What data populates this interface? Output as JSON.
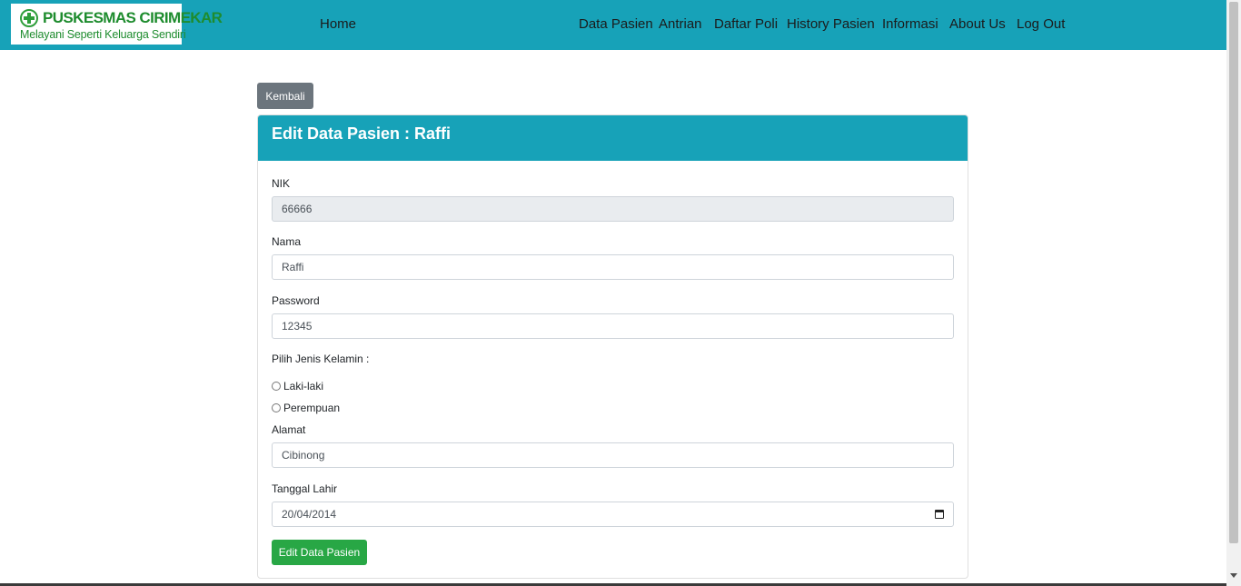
{
  "navbar": {
    "logo_title": "PUSKESMAS CIRIMEKAR",
    "logo_tagline": "Melayani Seperti Keluarga Sendiri",
    "links": [
      "Home",
      "Data Pasien",
      "Antrian",
      "Daftar Poli",
      "History Pasien",
      "Informasi",
      "About Us",
      "Log Out"
    ]
  },
  "back_button": "Kembali",
  "form": {
    "title": "Edit Data Pasien : Raffi",
    "nik_label": "NIK",
    "nik_value": "66666",
    "nama_label": "Nama",
    "nama_value": "Raffi",
    "password_label": "Password",
    "password_value": "12345",
    "gender_label": "Pilih Jenis Kelamin :",
    "gender_options": [
      "Laki-laki",
      "Perempuan"
    ],
    "alamat_label": "Alamat",
    "alamat_value": "Cibinong",
    "tanggal_label": "Tanggal Lahir",
    "tanggal_value": "20/04/2014",
    "submit_label": "Edit Data Pasien"
  },
  "colors": {
    "navbar": "#17a2b8",
    "back_button": "#6c757d",
    "submit_button": "#28a745",
    "logo_text": "#1e8c2e"
  },
  "icons": [
    "plus-cross-icon",
    "calendar-icon"
  ]
}
